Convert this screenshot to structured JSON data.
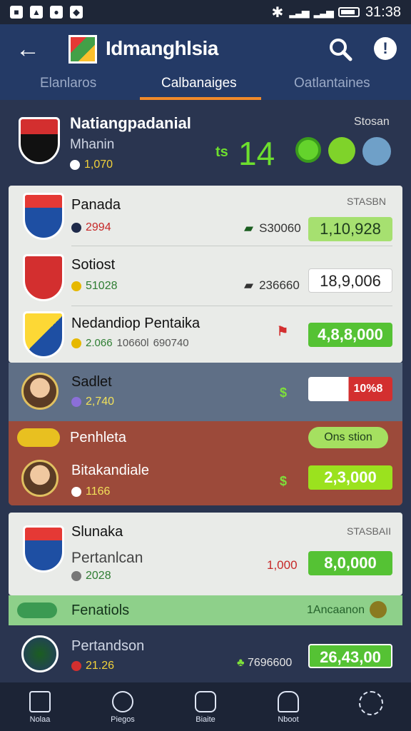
{
  "status": {
    "time": "31:38"
  },
  "app": {
    "title": "Idmanghlsia"
  },
  "tabs": [
    {
      "label": "Elanlaros"
    },
    {
      "label": "Calbanaiges"
    },
    {
      "label": "Oatlantaines"
    }
  ],
  "featured": {
    "name": "Natiangpadanial",
    "sub": "Mhanin",
    "count": "1,070",
    "label": "Stosan",
    "score_prefix": "ts",
    "score": "14"
  },
  "rows": [
    {
      "name": "Panada",
      "count": "2994",
      "stake": "S30060",
      "value": "1,10,928",
      "label": "STASBN"
    },
    {
      "name": "Sotiost",
      "count": "51028",
      "stake": "236660",
      "value": "18,9,006"
    },
    {
      "name": "Nedandiop Pentaika",
      "count": "2.066",
      "count2": "10660l",
      "count3": "690740",
      "value": "4,8,8,000"
    },
    {
      "name": "Sadlet",
      "count": "2,740",
      "value": "10%8"
    },
    {
      "name": "Bitakandiale",
      "count": "1166",
      "value": "2,3,000"
    },
    {
      "name": "Slunaka",
      "sub": "Pertanlcan",
      "count": "2028",
      "stake": "1,000",
      "value": "8,0,000",
      "label": "STASBAII"
    },
    {
      "name": "Pertandson",
      "count": "21.26",
      "stake": "7696600",
      "value": "26,43,00"
    }
  ],
  "sections": [
    {
      "label": "Penhleta",
      "badge": "Ons stion"
    },
    {
      "label": "Fenatiols",
      "badge": "1Ancaanon"
    }
  ],
  "nav": [
    {
      "label": "Nolaa"
    },
    {
      "label": "Piegos"
    },
    {
      "label": "Biaite"
    },
    {
      "label": "Nboot"
    },
    {
      "label": ""
    }
  ]
}
